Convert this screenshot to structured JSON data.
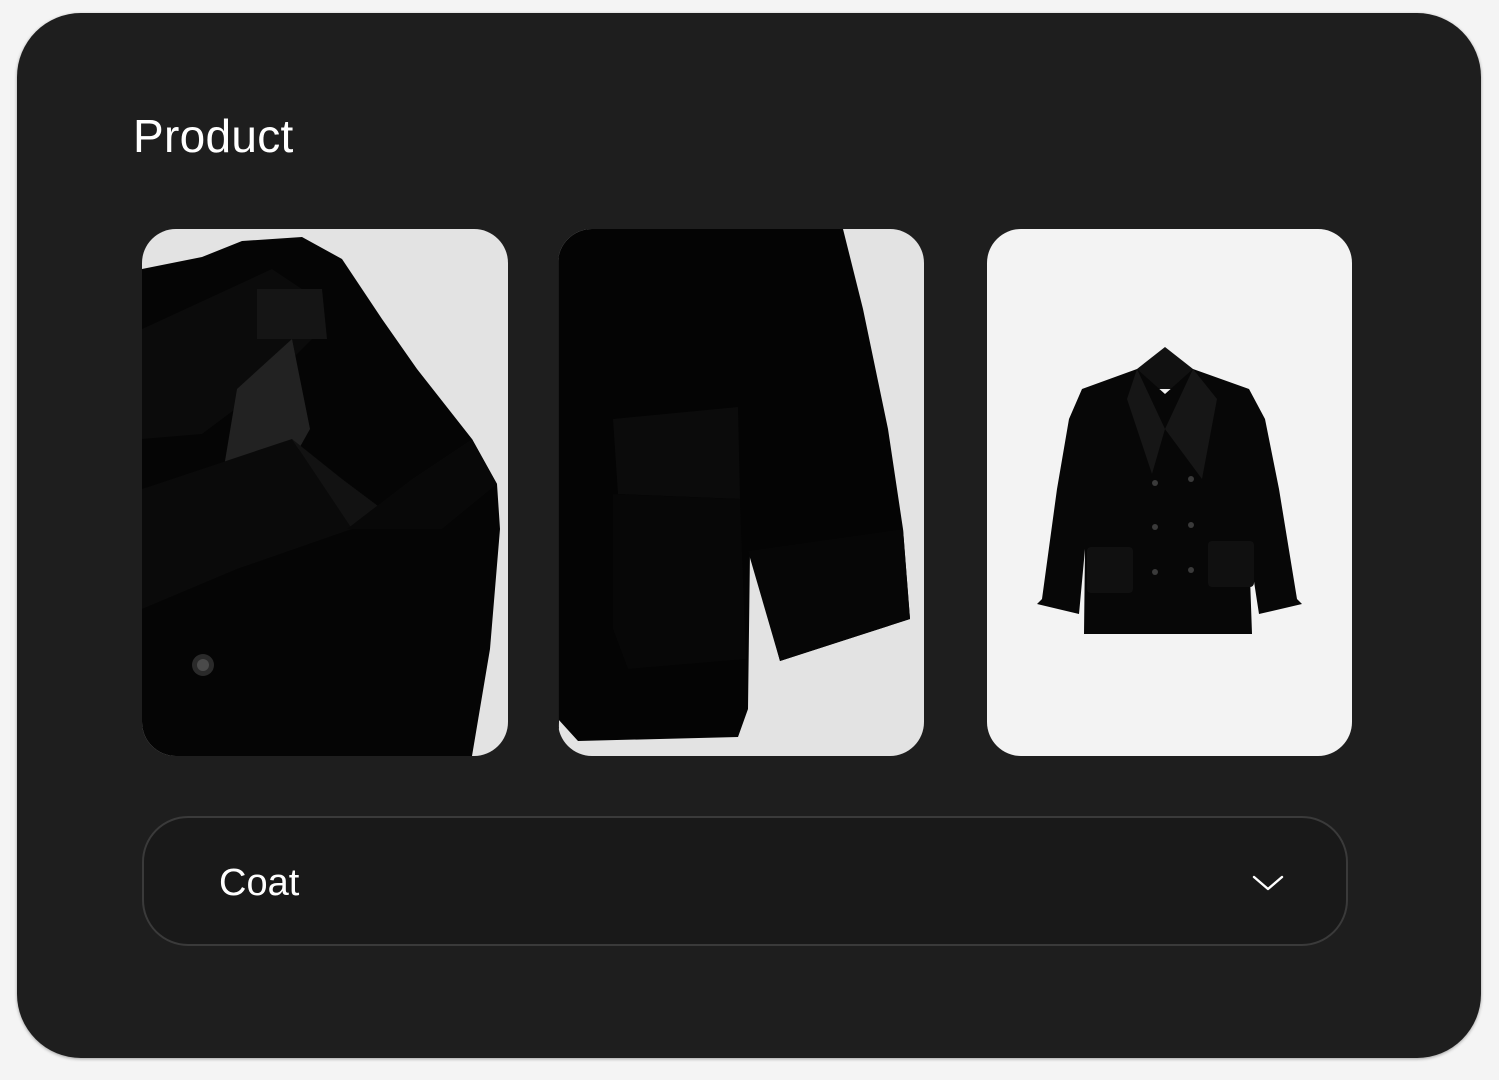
{
  "page": {
    "title": "Product"
  },
  "images": [
    {
      "name": "coat-collar-detail",
      "alt": "coat-collar-detail-image"
    },
    {
      "name": "coat-pocket-detail",
      "alt": "coat-pocket-detail-image"
    },
    {
      "name": "coat-full-view",
      "alt": "coat-full-view-image"
    }
  ],
  "select": {
    "value": "Coat",
    "icon": "chevron-down-icon"
  },
  "colors": {
    "card_background": "#1e1e1e",
    "text": "#ffffff",
    "field_border": "#3a3a3a"
  }
}
